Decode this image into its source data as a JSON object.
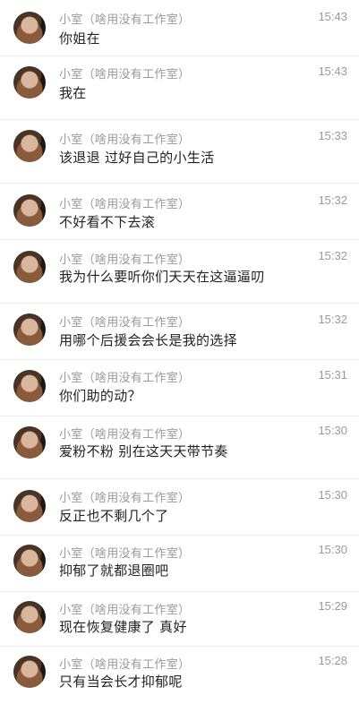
{
  "messages": [
    {
      "name": "小室（啥用没有工作室）",
      "time": "15:43",
      "text": "你姐在"
    },
    {
      "name": "小室（啥用没有工作室）",
      "time": "15:43",
      "text": "我在"
    },
    {
      "name": "小室（啥用没有工作室）",
      "time": "15:33",
      "text": "该退退 过好自己的小生活"
    },
    {
      "name": "小室（啥用没有工作室）",
      "time": "15:32",
      "text": "不好看不下去滚"
    },
    {
      "name": "小室（啥用没有工作室）",
      "time": "15:32",
      "text": "我为什么要听你们天天在这逼逼叨"
    },
    {
      "name": "小室（啥用没有工作室）",
      "time": "15:32",
      "text": "用哪个后援会会长是我的选择"
    },
    {
      "name": "小室（啥用没有工作室）",
      "time": "15:31",
      "text": "你们助的动？"
    },
    {
      "name": "小室（啥用没有工作室）",
      "time": "15:30",
      "text": "爱粉不粉 别在这天天带节奏"
    },
    {
      "name": "小室（啥用没有工作室）",
      "time": "15:30",
      "text": "反正也不剩几个了"
    },
    {
      "name": "小室（啥用没有工作室）",
      "time": "15:30",
      "text": "抑郁了就都退圈吧"
    },
    {
      "name": "小室（啥用没有工作室）",
      "time": "15:29",
      "text": "现在恢复健康了 真好"
    },
    {
      "name": "小室（啥用没有工作室）",
      "time": "15:28",
      "text": "只有当会长才抑郁呢"
    }
  ]
}
